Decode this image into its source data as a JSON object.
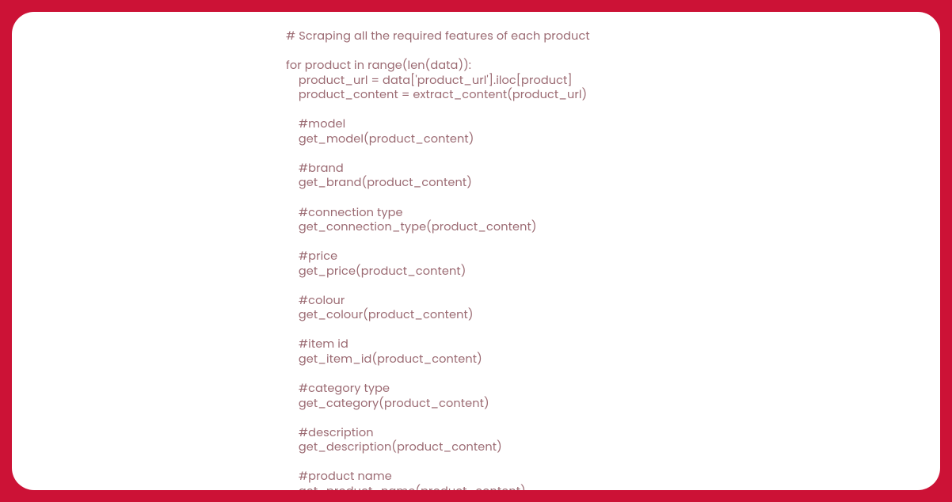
{
  "code": {
    "lines": [
      "# Scraping all the required features of each product",
      "",
      "for product in range(len(data)):",
      "    product_url = data['product_url'].iloc[product]",
      "    product_content = extract_content(product_url)",
      "",
      "    #model",
      "    get_model(product_content)",
      "",
      "    #brand",
      "    get_brand(product_content)",
      "",
      "    #connection type",
      "    get_connection_type(product_content)",
      "",
      "    #price",
      "    get_price(product_content)",
      "",
      "    #colour",
      "    get_colour(product_content)",
      "",
      "    #item id",
      "    get_item_id(product_content)",
      "",
      "    #category type",
      "    get_category(product_content)",
      "",
      "    #description",
      "    get_description(product_content)",
      "",
      "    #product name",
      "    get_product_name(product_content)"
    ]
  },
  "colors": {
    "background": "#cc1236",
    "card": "#ffffff",
    "text": "#9b6a72"
  }
}
